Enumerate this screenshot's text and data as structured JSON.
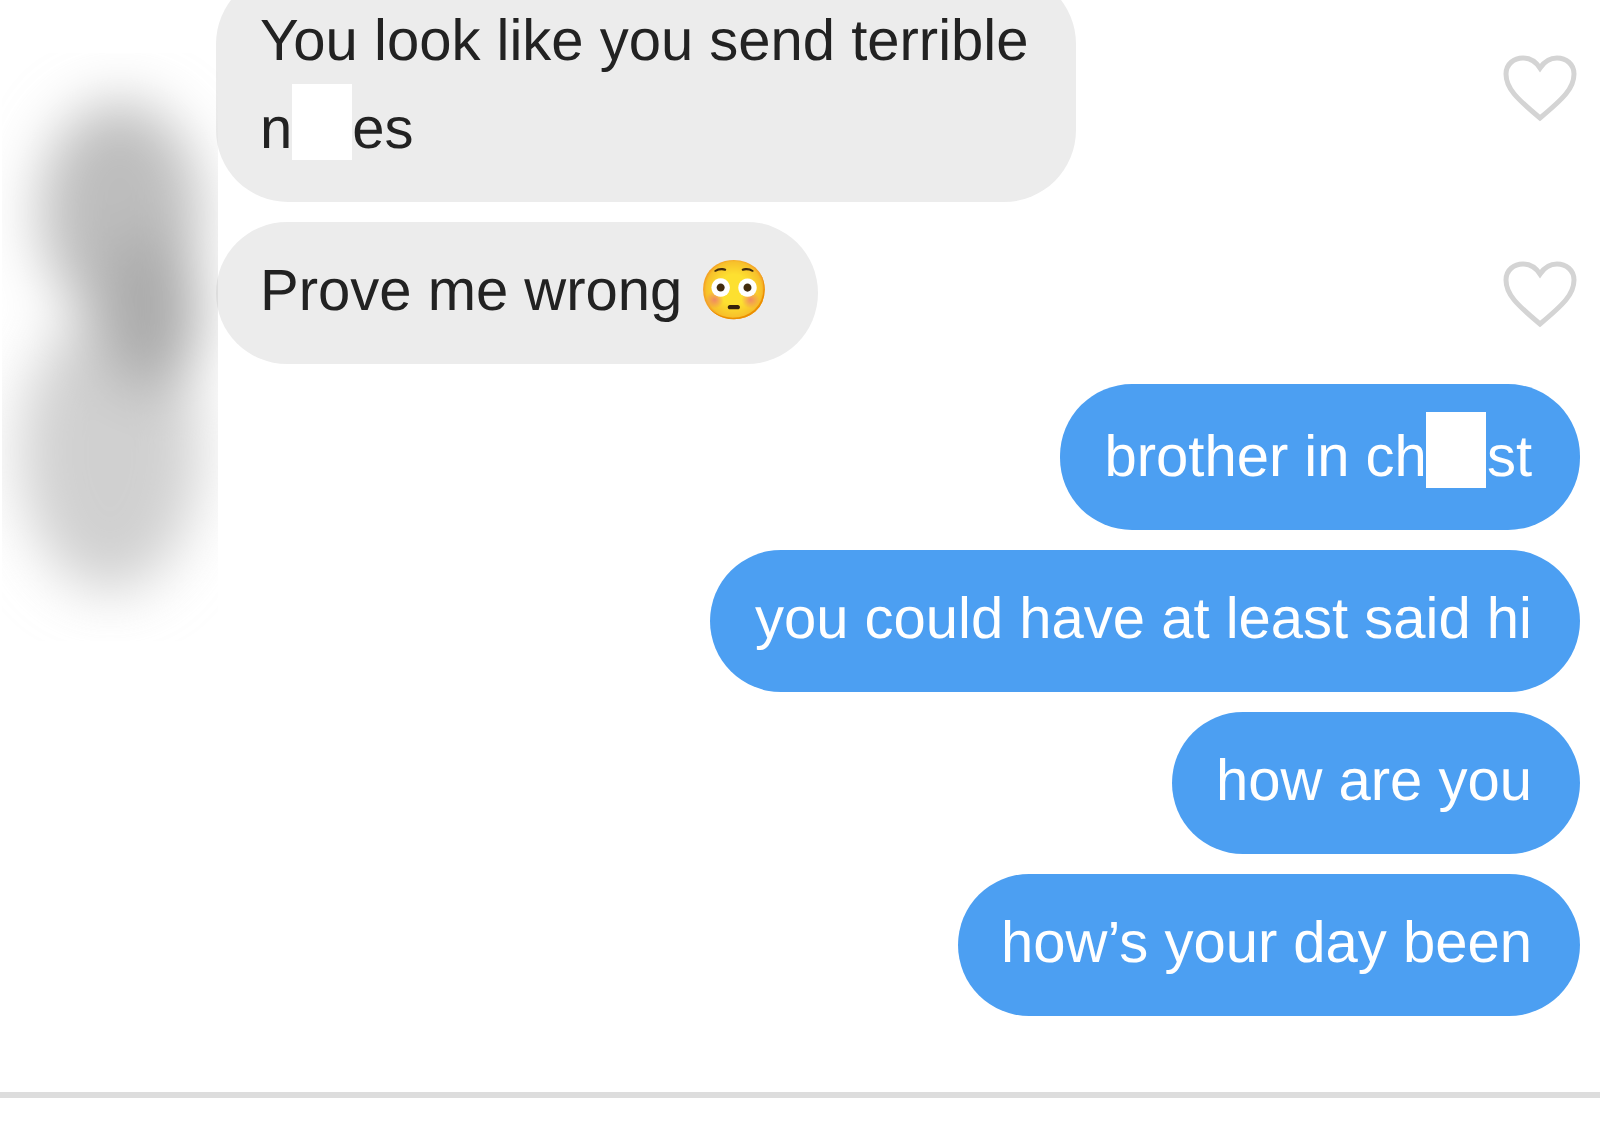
{
  "messages": [
    {
      "kind": "received",
      "segments": [
        {
          "kind": "text",
          "text": "You look like you send terrible"
        },
        {
          "kind": "break"
        },
        {
          "kind": "text",
          "text": "n"
        },
        {
          "kind": "redaction"
        },
        {
          "kind": "text",
          "text": "es"
        }
      ]
    },
    {
      "kind": "received",
      "segments": [
        {
          "kind": "text",
          "text": "Prove me wrong 😳"
        }
      ]
    },
    {
      "kind": "sent",
      "segments": [
        {
          "kind": "text",
          "text": "brother in ch"
        },
        {
          "kind": "redaction"
        },
        {
          "kind": "text",
          "text": "st"
        }
      ]
    },
    {
      "kind": "sent",
      "segments": [
        {
          "kind": "text",
          "text": "you could have at least said hi"
        }
      ]
    },
    {
      "kind": "sent",
      "segments": [
        {
          "kind": "text",
          "text": "how are you"
        }
      ]
    },
    {
      "kind": "sent",
      "segments": [
        {
          "kind": "text",
          "text": "how’s your day been"
        }
      ]
    }
  ]
}
